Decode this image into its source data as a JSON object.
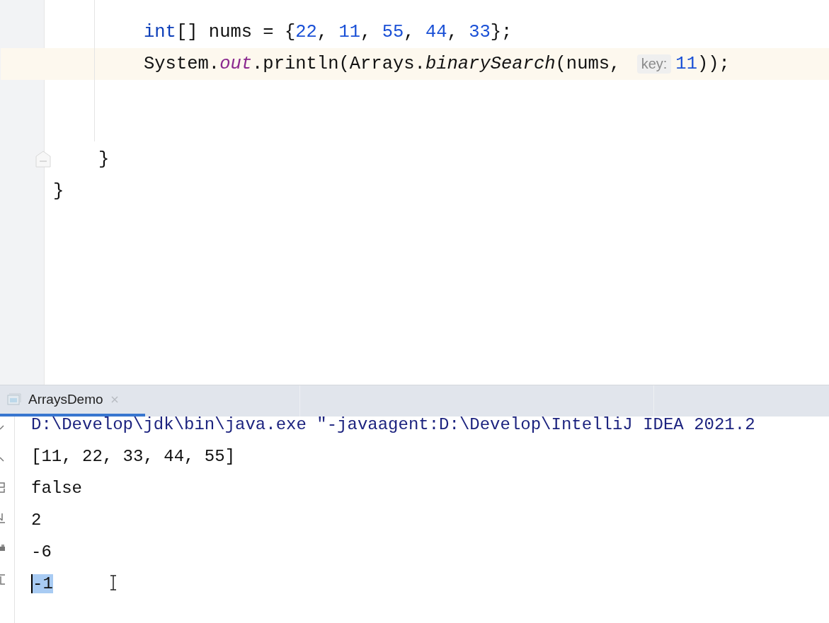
{
  "editor": {
    "lines": [
      {
        "kind": "stmt",
        "current": false,
        "tokens": [
          {
            "kind": "keyword",
            "text": "int"
          },
          {
            "kind": "plain",
            "text": "[] nums = {"
          },
          {
            "kind": "number",
            "text": "22"
          },
          {
            "kind": "plain",
            "text": ", "
          },
          {
            "kind": "number",
            "text": "11"
          },
          {
            "kind": "plain",
            "text": ", "
          },
          {
            "kind": "number",
            "text": "55"
          },
          {
            "kind": "plain",
            "text": ", "
          },
          {
            "kind": "number",
            "text": "44"
          },
          {
            "kind": "plain",
            "text": ", "
          },
          {
            "kind": "number",
            "text": "33"
          },
          {
            "kind": "plain",
            "text": "};"
          }
        ]
      },
      {
        "kind": "stmt",
        "current": true,
        "tokens": [
          {
            "kind": "plain",
            "text": "System."
          },
          {
            "kind": "field",
            "text": "out"
          },
          {
            "kind": "plain",
            "text": ".println(Arrays."
          },
          {
            "kind": "method",
            "text": "binarySearch"
          },
          {
            "kind": "plain",
            "text": "(nums, "
          },
          {
            "kind": "hint",
            "text": "key:"
          },
          {
            "kind": "number",
            "text": "11"
          },
          {
            "kind": "plain",
            "text": "));"
          }
        ]
      },
      {
        "kind": "blank",
        "current": false
      },
      {
        "kind": "blank",
        "current": false
      },
      {
        "kind": "inner-close",
        "current": false,
        "tokens": [
          {
            "kind": "plain",
            "text": "}"
          }
        ]
      },
      {
        "kind": "outer-close",
        "current": false,
        "tokens": [
          {
            "kind": "plain",
            "text": "}"
          }
        ]
      }
    ]
  },
  "run_panel": {
    "tabs": [
      {
        "label": "ArraysDemo",
        "selected": true
      }
    ],
    "console": [
      {
        "kind": "command",
        "text": "D:\\Develop\\jdk\\bin\\java.exe \"-javaagent:D:\\Develop\\IntelliJ IDEA 2021.2",
        "selected": false
      },
      {
        "kind": "output",
        "text": "[11, 22, 33, 44, 55]",
        "selected": false
      },
      {
        "kind": "output",
        "text": "false",
        "selected": false
      },
      {
        "kind": "output",
        "text": "2",
        "selected": false
      },
      {
        "kind": "output",
        "text": "-6",
        "selected": false
      },
      {
        "kind": "output",
        "text": "-1",
        "selected": true
      }
    ]
  }
}
